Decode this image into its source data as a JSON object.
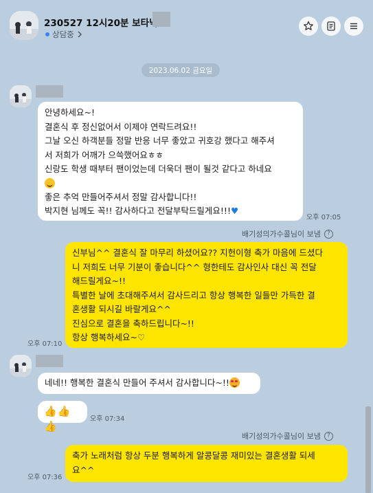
{
  "header": {
    "title": "230527 12시20분 보타닉",
    "status": "상담중",
    "status_chevron": "chevron-right-icon",
    "icons": [
      "star-icon",
      "list-icon",
      "menu-icon"
    ]
  },
  "date_divider": "2023.06.02 금요일",
  "messages": {
    "m1": {
      "lines": [
        "안녕하세요~!",
        "결혼식 후 정신없어서 이제야 연락드려요!!",
        "그날 오신 하객분들 정말 반응 너무 좋았고 귀호강 했다고 해주셔",
        "서 저희가 어깨가 으쓱했어요ㅎㅎ",
        "신랑도 학생 때부터 팬이었는데 더욱더 팬이 될것 같다고 하네요",
        "좋은 추억 만들어주셔서 정말 감사합니다!!",
        "박지현 님께도 꼭!! 감사하다고 전달부탁드릴게요!!!"
      ],
      "time": "오후 07:05"
    },
    "sent_by_1": "배기성의가수콜님이 보냄",
    "m2": {
      "lines": [
        "신부님^^ 결혼식 잘 마무리 하셨어요?? 지헌이형 축가 마음에 드셨다",
        "니 저희도 너무 기분이 좋습니다^^ 형한테도 감사인사 대신 꼭 전달",
        "해드릴게요~!!",
        "특별한 날에 초대해주셔서 감사드리고 항상 행복한 일들만 가득한 결",
        "혼생활 되시길 바랄게요^^",
        "진심으로 결혼을 축하드립니다~!!",
        "항상 행복하세요~♡"
      ],
      "time": "오후 07:10"
    },
    "m3": {
      "text": "네네!! 행복한 결혼식 만들어 주셔서 감사합니다~!!",
      "thumbs": "👍👍👍",
      "time": "오후 07:34"
    },
    "sent_by_2": "배기성의가수콜님이 보냄",
    "m4": {
      "lines": [
        "축가 노래처럼 항상 두분 행복하게 알콩달콩 재미있는 결혼생활 되세",
        "요^^"
      ],
      "time": "오후 07:36"
    }
  },
  "colors": {
    "background": "#bacee0",
    "my_bubble": "#fee500",
    "their_bubble": "#ffffff",
    "status_dot": "#3b82f6"
  }
}
